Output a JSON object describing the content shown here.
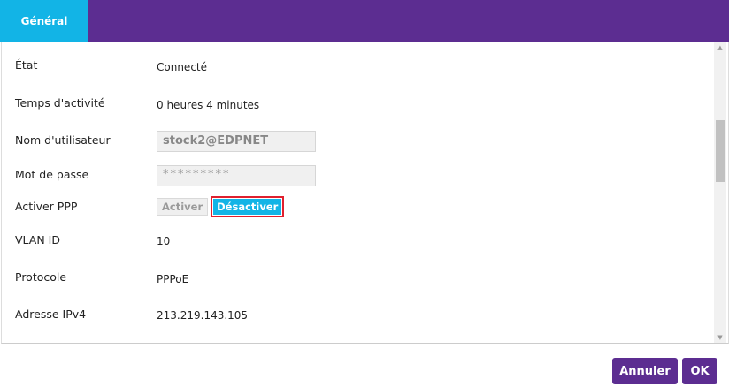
{
  "tabs": [
    {
      "label": "Général"
    }
  ],
  "fields": {
    "etat": {
      "label": "État",
      "value": "Connecté"
    },
    "temps": {
      "label": "Temps d'activité",
      "value": "0 heures 4 minutes"
    },
    "user": {
      "label": "Nom d'utilisateur",
      "value": "stock2@EDPNET"
    },
    "password": {
      "label": "Mot de passe",
      "value": "*********"
    },
    "ppp": {
      "label": "Activer PPP",
      "on_label": "Activer",
      "off_label": "Désactiver",
      "selected": "Désactiver"
    },
    "vlan": {
      "label": "VLAN ID",
      "value": "10"
    },
    "protocole": {
      "label": "Protocole",
      "value": "PPPoE"
    },
    "ipv4": {
      "label": "Adresse IPv4",
      "value": "213.219.143.105"
    }
  },
  "footer": {
    "cancel_label": "Annuler",
    "ok_label": "OK"
  },
  "colors": {
    "header": "#5c2d91",
    "accent": "#12b4e6",
    "highlight": "#e0202e"
  },
  "icons": {
    "scroll_up": "triangle-up",
    "scroll_down": "triangle-down"
  }
}
